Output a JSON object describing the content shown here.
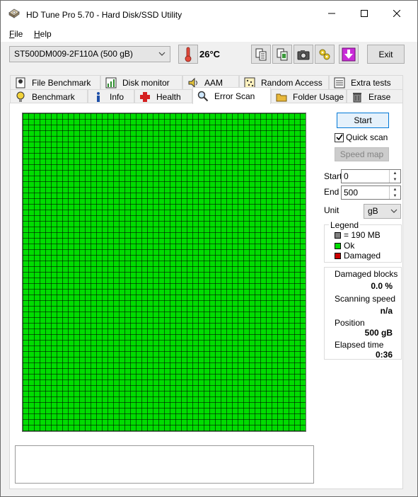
{
  "window": {
    "title": "HD Tune Pro 5.70 - Hard Disk/SSD Utility",
    "controls": {
      "minimize": "—",
      "maximize": "☐",
      "close": "✕"
    }
  },
  "menu": {
    "file_accel": "F",
    "file_rest": "ile",
    "help_accel": "H",
    "help_rest": "elp"
  },
  "toolbar": {
    "drive": "ST500DM009-2F110A (500 gB)",
    "temperature": "26°C",
    "exit_label": "Exit",
    "icons": [
      "copy-text-icon",
      "copy-info-icon",
      "screenshot-icon",
      "options-icon",
      "save-icon"
    ]
  },
  "tabs": {
    "row1": [
      "File Benchmark",
      "Disk monitor",
      "AAM",
      "Random Access",
      "Extra tests"
    ],
    "row2": [
      "Benchmark",
      "Info",
      "Health",
      "Error Scan",
      "Folder Usage",
      "Erase"
    ],
    "active": "Error Scan"
  },
  "scan": {
    "start_label": "Start",
    "quick_scan_label": "Quick scan",
    "quick_scan_checked": true,
    "speed_map_label": "Speed map",
    "start_field_label": "Start",
    "start_value": "0",
    "end_field_label": "End",
    "end_value": "500",
    "unit_label": "Unit",
    "unit_value": "gB"
  },
  "legend": {
    "title": "Legend",
    "block_size": "= 190 MB",
    "ok": "Ok",
    "damaged": "Damaged",
    "colors": {
      "block": "#808080",
      "ok": "#00dc00",
      "damaged": "#cc0000"
    }
  },
  "stats": {
    "damaged_blocks_label": "Damaged blocks",
    "damaged_blocks_value": "0.0 %",
    "scanning_speed_label": "Scanning speed",
    "scanning_speed_value": "n/a",
    "position_label": "Position",
    "position_value": "500 gB",
    "elapsed_label": "Elapsed time",
    "elapsed_value": "0:36"
  },
  "colors": {
    "ok_green": "#00dc00",
    "accent": "#0078d7"
  }
}
